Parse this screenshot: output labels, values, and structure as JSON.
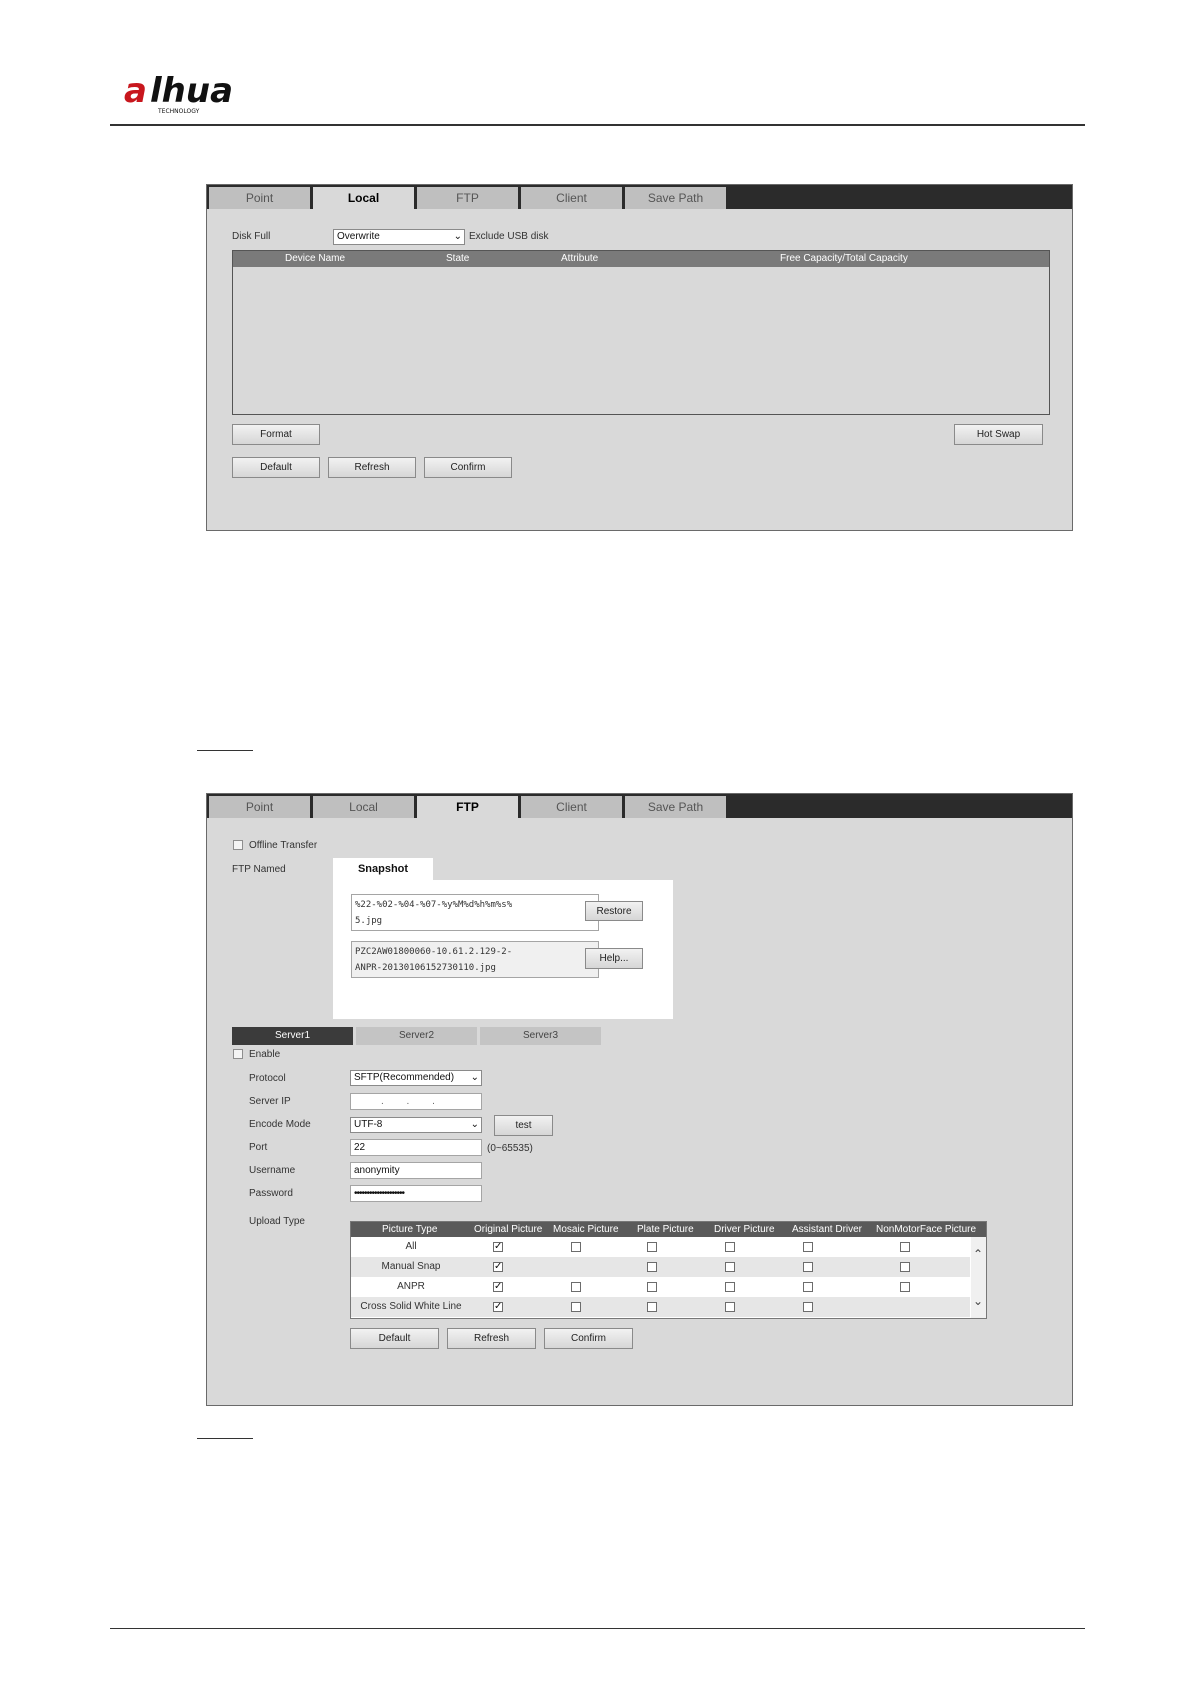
{
  "brand": {
    "logo_text": "alhua",
    "logo_sub": "TECHNOLOGY"
  },
  "tabs": [
    "Point",
    "Local",
    "FTP",
    "Client",
    "Save Path"
  ],
  "local": {
    "active_tab": "Local",
    "disk_full_label": "Disk Full",
    "disk_full_value": "Overwrite",
    "exclude_usb_label": "Exclude USB disk",
    "columns": [
      "Device Name",
      "State",
      "Attribute",
      "Free Capacity/Total Capacity"
    ],
    "buttons": {
      "format": "Format",
      "hot_swap": "Hot Swap",
      "default": "Default",
      "refresh": "Refresh",
      "confirm": "Confirm"
    }
  },
  "ftp": {
    "active_tab": "FTP",
    "offline_transfer_label": "Offline Transfer",
    "ftp_named_label": "FTP Named",
    "snapshot_tab": "Snapshot",
    "name_pattern_line1": "%22-%02-%04-%07-%y%M%d%h%m%s%",
    "name_pattern_line2": "5.jpg",
    "example_line1": "PZC2AW01800060-10.61.2.129-2-",
    "example_line2": "ANPR-20130106152730110.jpg",
    "restore_button": "Restore",
    "help_button": "Help...",
    "server_tabs": [
      "Server1",
      "Server2",
      "Server3"
    ],
    "enable_label": "Enable",
    "protocol_label": "Protocol",
    "protocol_value": "SFTP(Recommended)",
    "server_ip_label": "Server IP",
    "server_ip_value": ". . .",
    "encode_mode_label": "Encode Mode",
    "encode_mode_value": "UTF-8",
    "test_button": "test",
    "port_label": "Port",
    "port_value": "22",
    "port_range": "(0~65535)",
    "username_label": "Username",
    "username_value": "anonymity",
    "password_label": "Password",
    "password_value": "••••••••••••••••••••",
    "upload_type_label": "Upload Type",
    "upload_columns": [
      "Picture Type",
      "Original Picture",
      "Mosaic Picture",
      "Plate Picture",
      "Driver Picture",
      "Assistant Driver",
      "NonMotorFace Picture"
    ],
    "upload_rows": [
      {
        "name": "All",
        "checks": [
          true,
          false,
          false,
          false,
          false,
          false
        ]
      },
      {
        "name": "Manual Snap",
        "checks": [
          true,
          null,
          false,
          false,
          false,
          false
        ]
      },
      {
        "name": "ANPR",
        "checks": [
          true,
          false,
          false,
          false,
          false,
          false
        ]
      },
      {
        "name": "Cross Solid White Line",
        "checks": [
          true,
          false,
          false,
          false,
          false,
          null
        ]
      }
    ],
    "buttons": {
      "default": "Default",
      "refresh": "Refresh",
      "confirm": "Confirm"
    }
  }
}
